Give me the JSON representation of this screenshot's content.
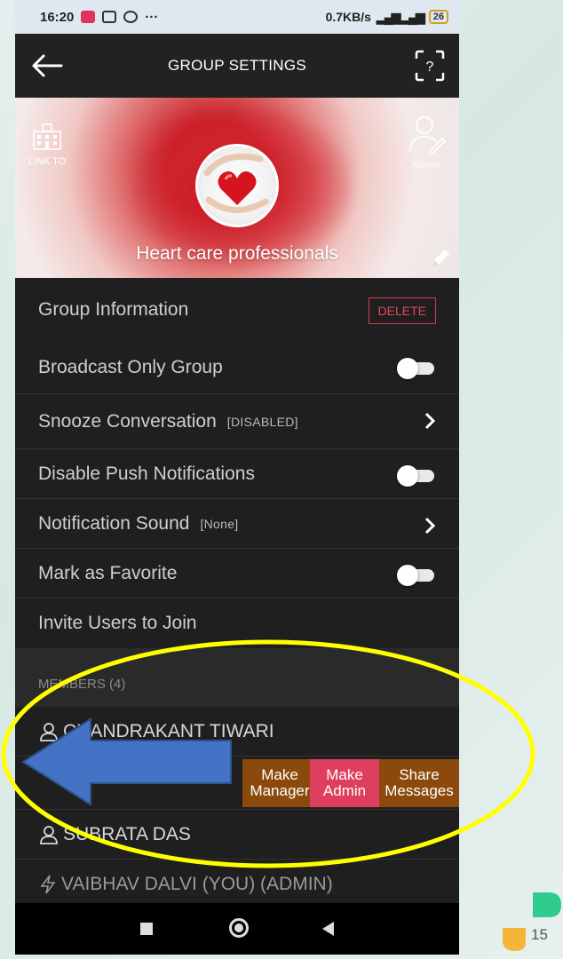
{
  "status_bar": {
    "time": "16:20",
    "ellipsis": "···",
    "network_speed": "0.7KB/s",
    "battery": "26"
  },
  "header": {
    "title": "GROUP SETTINGS",
    "back_icon": "arrow-left-icon",
    "scan_icon": "qr-scan-icon"
  },
  "banner": {
    "link_to_label": "LINK TO",
    "admin_label": "ADMIN",
    "group_name": "Heart care professionals"
  },
  "settings": {
    "group_information": "Group Information",
    "delete_label": "DELETE",
    "broadcast_only": "Broadcast Only Group",
    "snooze": "Snooze Conversation",
    "snooze_tag": "[DISABLED]",
    "disable_push": "Disable Push Notifications",
    "notification_sound": "Notification Sound",
    "notification_sound_tag": "[None]",
    "mark_favorite": "Mark as Favorite",
    "invite_users": "Invite Users to Join"
  },
  "members": {
    "header": "MEMBERS (4)",
    "list": [
      {
        "name": "CHANDRAKANT TIWARI"
      },
      {
        "name": "SUBRATA DAS"
      },
      {
        "name": "VAIBHAV DALVI (YOU) (ADMIN)"
      }
    ],
    "swipe_actions": {
      "make_manager_line1": "Make",
      "make_manager_line2": "Manager",
      "make_admin_line1": "Make",
      "make_admin_line2": "Admin",
      "share_line1": "Share",
      "share_line2": "Messages"
    }
  },
  "slide": {
    "page_number": "15"
  },
  "colors": {
    "delete": "#e04858",
    "make_admin": "#df3f5e",
    "make_manager": "#8b4a0b",
    "highlight_ellipse": "#ffff00",
    "arrow": "#4472c4"
  }
}
